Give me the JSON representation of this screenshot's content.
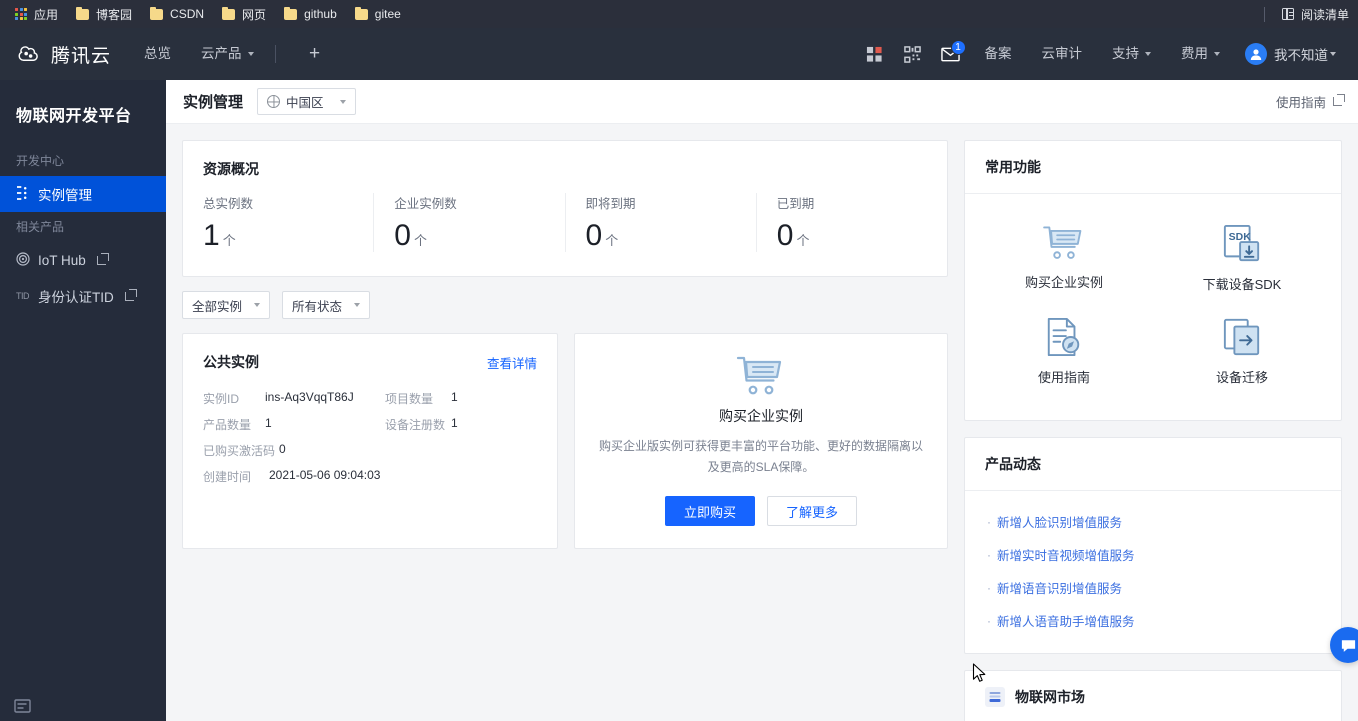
{
  "browser": {
    "apps_label": "应用",
    "bookmarks": [
      {
        "label": "博客园",
        "icon": "folder-icon"
      },
      {
        "label": "CSDN",
        "icon": "folder-icon"
      },
      {
        "label": "网页",
        "icon": "folder-icon"
      },
      {
        "label": "github",
        "icon": "folder-icon"
      },
      {
        "label": "gitee",
        "icon": "folder-icon"
      }
    ],
    "reading_list": "阅读清单",
    "reading_list_icon": "reading-list-icon"
  },
  "topnav": {
    "brand": "腾讯云",
    "brand_icon": "tencent-cloud-logo",
    "links": [
      {
        "label": "总览",
        "has_caret": false
      },
      {
        "label": "云产品",
        "has_caret": true
      }
    ],
    "add_tab_label": "+",
    "right_icons": [
      {
        "name": "dashboard-icon"
      },
      {
        "name": "qrcode-icon"
      }
    ],
    "message_icon": "mail-icon",
    "message_badge": "1",
    "right_links": [
      {
        "label": "备案",
        "has_caret": false
      },
      {
        "label": "云审计",
        "has_caret": false
      },
      {
        "label": "支持",
        "has_caret": true
      },
      {
        "label": "费用",
        "has_caret": true
      }
    ],
    "user": {
      "name": "我不知道",
      "avatar_icon": "user-avatar-icon"
    }
  },
  "sidebar": {
    "title": "物联网开发平台",
    "groups": [
      {
        "label": "开发中心",
        "items": [
          {
            "label": "实例管理",
            "icon": "instance-icon",
            "active": true,
            "external": false
          }
        ]
      },
      {
        "label": "相关产品",
        "items": [
          {
            "label": "IoT Hub",
            "icon": "iot-hub-icon",
            "active": false,
            "external": true
          },
          {
            "label": "身份认证TID",
            "icon": "tid-icon",
            "active": false,
            "external": true
          }
        ]
      }
    ],
    "collapse_icon": "collapse-sidebar-icon"
  },
  "page": {
    "title": "实例管理",
    "region": {
      "label": "中国区",
      "icon": "globe-icon"
    },
    "guide_link": "使用指南"
  },
  "resource_overview": {
    "title": "资源概况",
    "stats": [
      {
        "label": "总实例数",
        "value": "1",
        "unit": "个"
      },
      {
        "label": "企业实例数",
        "value": "0",
        "unit": "个"
      },
      {
        "label": "即将到期",
        "value": "0",
        "unit": "个"
      },
      {
        "label": "已到期",
        "value": "0",
        "unit": "个"
      }
    ]
  },
  "filters": [
    {
      "label": "全部实例"
    },
    {
      "label": "所有状态"
    }
  ],
  "public_instance": {
    "title": "公共实例",
    "detail_link": "查看详情",
    "fields": [
      {
        "key": "实例ID",
        "value": "ins-Aq3VqqT86J"
      },
      {
        "key": "项目数量",
        "value": "1"
      },
      {
        "key": "产品数量",
        "value": "1"
      },
      {
        "key": "设备注册数",
        "value": "1"
      },
      {
        "key": "已购买激活码",
        "value": "0"
      },
      {
        "key": "创建时间",
        "value": "2021-05-06 09:04:03"
      }
    ]
  },
  "buy_card": {
    "icon": "shopping-cart-icon",
    "title": "购买企业实例",
    "desc": "购买企业版实例可获得更丰富的平台功能、更好的数据隔离以及更高的SLA保障。",
    "primary_button": "立即购买",
    "secondary_button": "了解更多"
  },
  "common_functions": {
    "title": "常用功能",
    "items": [
      {
        "label": "购买企业实例",
        "icon": "shopping-cart-icon"
      },
      {
        "label": "下载设备SDK",
        "icon": "sdk-download-icon"
      },
      {
        "label": "使用指南",
        "icon": "guide-doc-icon"
      },
      {
        "label": "设备迁移",
        "icon": "device-migrate-icon"
      }
    ]
  },
  "product_news": {
    "title": "产品动态",
    "items": [
      {
        "label": "新增人脸识别增值服务"
      },
      {
        "label": "新增实时音视频增值服务"
      },
      {
        "label": "新增语音识别增值服务"
      },
      {
        "label": "新增人语音助手增值服务"
      }
    ]
  },
  "iot_market": {
    "title": "物联网市场",
    "icon": "market-icon"
  },
  "floating_button": {
    "icon": "chat-bubble-icon"
  },
  "colors": {
    "accent": "#1664ff",
    "sidebar_active": "#0052d9",
    "nav_bg": "#29303d",
    "sidebar_bg": "#252c3b",
    "page_bg": "#f4f5f7",
    "icon_blue": "#96b6d8"
  }
}
